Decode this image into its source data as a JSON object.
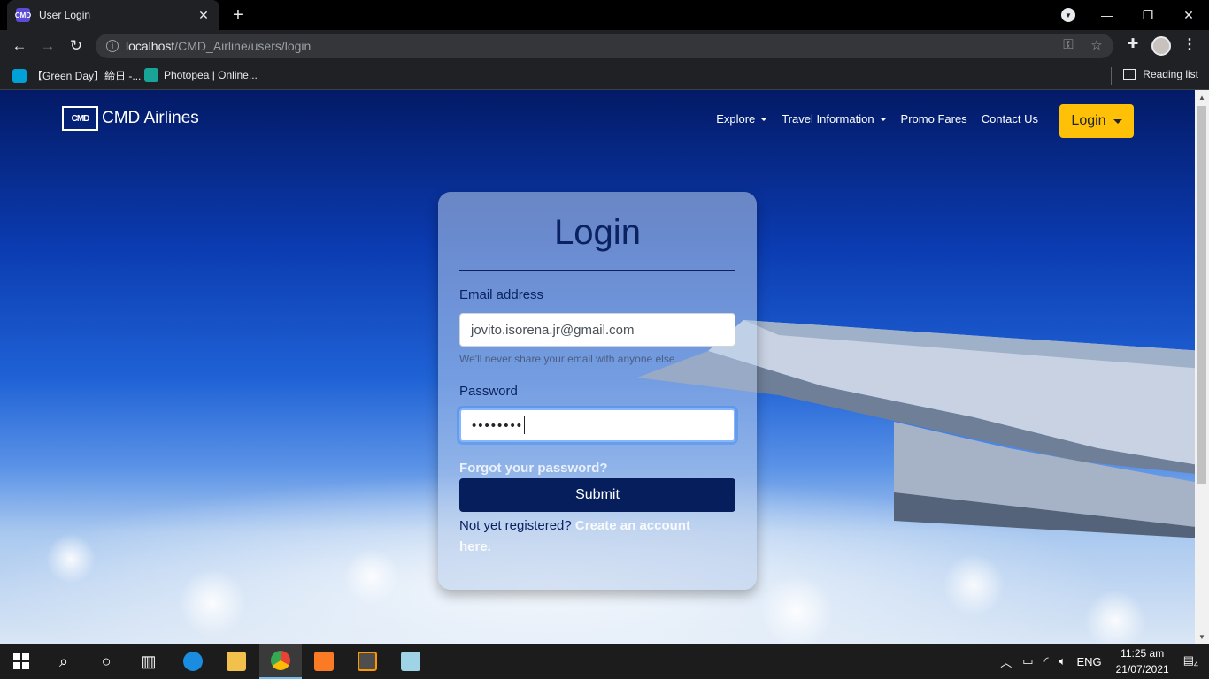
{
  "browser": {
    "tab_title": "User Login",
    "tab_favicon": "CMD",
    "url_host": "localhost",
    "url_path": "/CMD_Airline/users/login",
    "bookmarks": [
      {
        "label": "【Green Day】締日 -..."
      },
      {
        "label": "Photopea | Online..."
      }
    ],
    "reading_list": "Reading list"
  },
  "site": {
    "brand_logo": "CMD",
    "brand_name": "CMD Airlines",
    "nav": {
      "explore": "Explore",
      "travel_info": "Travel Information",
      "promo": "Promo Fares",
      "contact": "Contact Us",
      "login": "Login"
    }
  },
  "login_form": {
    "title": "Login",
    "email_label": "Email address",
    "email_value": "jovito.isorena.jr@gmail.com",
    "email_hint": "We'll never share your email with anyone else.",
    "password_label": "Password",
    "password_value": "••••••••",
    "forgot": "Forgot your password?",
    "submit": "Submit",
    "register_prefix": "Not yet registered? ",
    "register_link": "Create an account here."
  },
  "taskbar": {
    "language": "ENG",
    "time": "11:25 am",
    "date": "21/07/2021",
    "notifications": "4"
  },
  "colors": {
    "accent_yellow": "#ffc107",
    "submit_navy": "#061f5c",
    "title_navy": "#0b2260"
  }
}
